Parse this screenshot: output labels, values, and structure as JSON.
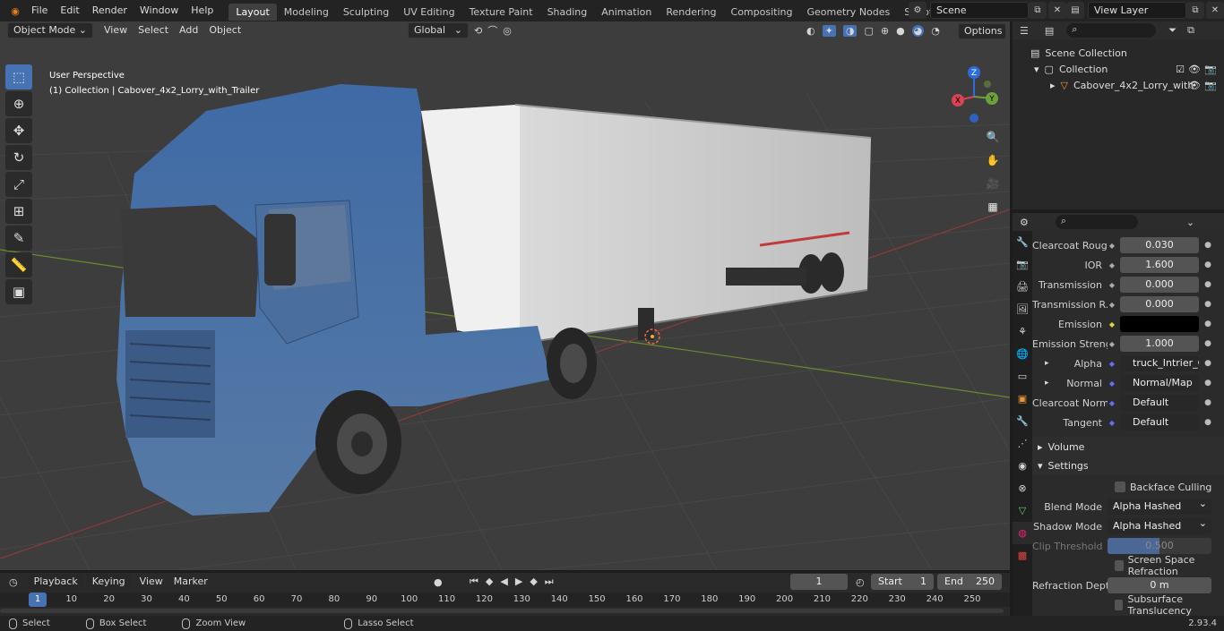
{
  "menu": [
    "File",
    "Edit",
    "Render",
    "Window",
    "Help"
  ],
  "workspaces": [
    {
      "label": "Layout",
      "active": true
    },
    {
      "label": "Modeling"
    },
    {
      "label": "Sculpting"
    },
    {
      "label": "UV Editing"
    },
    {
      "label": "Texture Paint"
    },
    {
      "label": "Shading"
    },
    {
      "label": "Animation"
    },
    {
      "label": "Rendering"
    },
    {
      "label": "Compositing"
    },
    {
      "label": "Geometry Nodes"
    },
    {
      "label": "Scripting"
    }
  ],
  "scene": {
    "name": "Scene",
    "view_layer": "View Layer"
  },
  "viewport": {
    "mode": "Object Mode",
    "menus": [
      "View",
      "Select",
      "Add",
      "Object"
    ],
    "transform": "Global",
    "options": "Options",
    "perspective": "User Perspective",
    "object_info": "(1) Collection | Cabover_4x2_Lorry_with_Trailer",
    "gizmo": {
      "x": "X",
      "y": "Y",
      "z": "Z"
    }
  },
  "outliner": {
    "scene_collection": "Scene Collection",
    "collection": "Collection",
    "object": "Cabover_4x2_Lorry_with"
  },
  "properties": {
    "rows": [
      {
        "label": "Clearcoat Roug...",
        "value": "0.030",
        "type": "num"
      },
      {
        "label": "IOR",
        "value": "1.600",
        "type": "num"
      },
      {
        "label": "Transmission",
        "value": "0.000",
        "type": "num"
      },
      {
        "label": "Transmission R...",
        "value": "0.000",
        "type": "num"
      },
      {
        "label": "Emission",
        "value": "",
        "type": "color"
      },
      {
        "label": "Emission Strengt",
        "value": "1.000",
        "type": "num"
      },
      {
        "label": "Alpha",
        "value": "truck_Intrier_Opacit...",
        "type": "link"
      },
      {
        "label": "Normal",
        "value": "Normal/Map",
        "type": "link"
      },
      {
        "label": "Clearcoat Normal",
        "value": "Default",
        "type": "link"
      },
      {
        "label": "Tangent",
        "value": "Default",
        "type": "link"
      }
    ],
    "volume": "Volume",
    "settings": "Settings",
    "backface": "Backface Culling",
    "blend_mode_label": "Blend Mode",
    "blend_mode": "Alpha Hashed",
    "shadow_mode_label": "Shadow Mode",
    "shadow_mode": "Alpha Hashed",
    "clip_label": "Clip Threshold",
    "clip_value": "0.500",
    "ssr": "Screen Space Refraction",
    "refraction_label": "Refraction Depth",
    "refraction_value": "0 m",
    "subsurface": "Subsurface Translucency"
  },
  "timeline": {
    "menus": [
      "Playback",
      "Keying",
      "View",
      "Marker"
    ],
    "current_frame": "1",
    "start_label": "Start",
    "start": "1",
    "end_label": "End",
    "end": "250",
    "ticks": [
      "1",
      "10",
      "20",
      "30",
      "40",
      "50",
      "60",
      "70",
      "80",
      "90",
      "100",
      "110",
      "120",
      "130",
      "140",
      "150",
      "160",
      "170",
      "180",
      "190",
      "200",
      "210",
      "220",
      "230",
      "240",
      "250"
    ]
  },
  "status": {
    "select": "Select",
    "box_select": "Box Select",
    "zoom": "Zoom View",
    "lasso": "Lasso Select",
    "version": "2.93.4"
  },
  "colors": {
    "accent": "#4772b3",
    "truck_blue": "#4a6f9e",
    "trailer": "#dcdcdc"
  }
}
